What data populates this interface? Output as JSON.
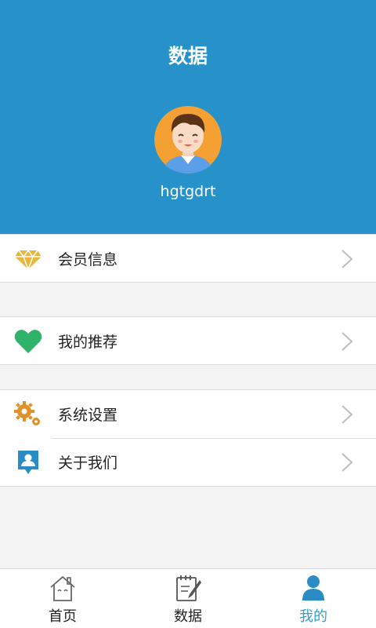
{
  "header": {
    "title": "数据",
    "username": "hgtgdrt",
    "background": "#2692c9"
  },
  "menu": {
    "group1": [
      {
        "label": "会员信息",
        "icon": "diamond-icon"
      }
    ],
    "group2": [
      {
        "label": "我的推荐",
        "icon": "heart-icon"
      }
    ],
    "group3": [
      {
        "label": "系统设置",
        "icon": "gear-icon"
      },
      {
        "label": "关于我们",
        "icon": "contact-card-icon"
      }
    ]
  },
  "tabbar": {
    "tabs": [
      {
        "label": "首页",
        "icon": "home-icon",
        "active": false
      },
      {
        "label": "数据",
        "icon": "notepad-icon",
        "active": false
      },
      {
        "label": "我的",
        "icon": "person-icon",
        "active": true
      }
    ],
    "active_color": "#2ba0d3"
  }
}
